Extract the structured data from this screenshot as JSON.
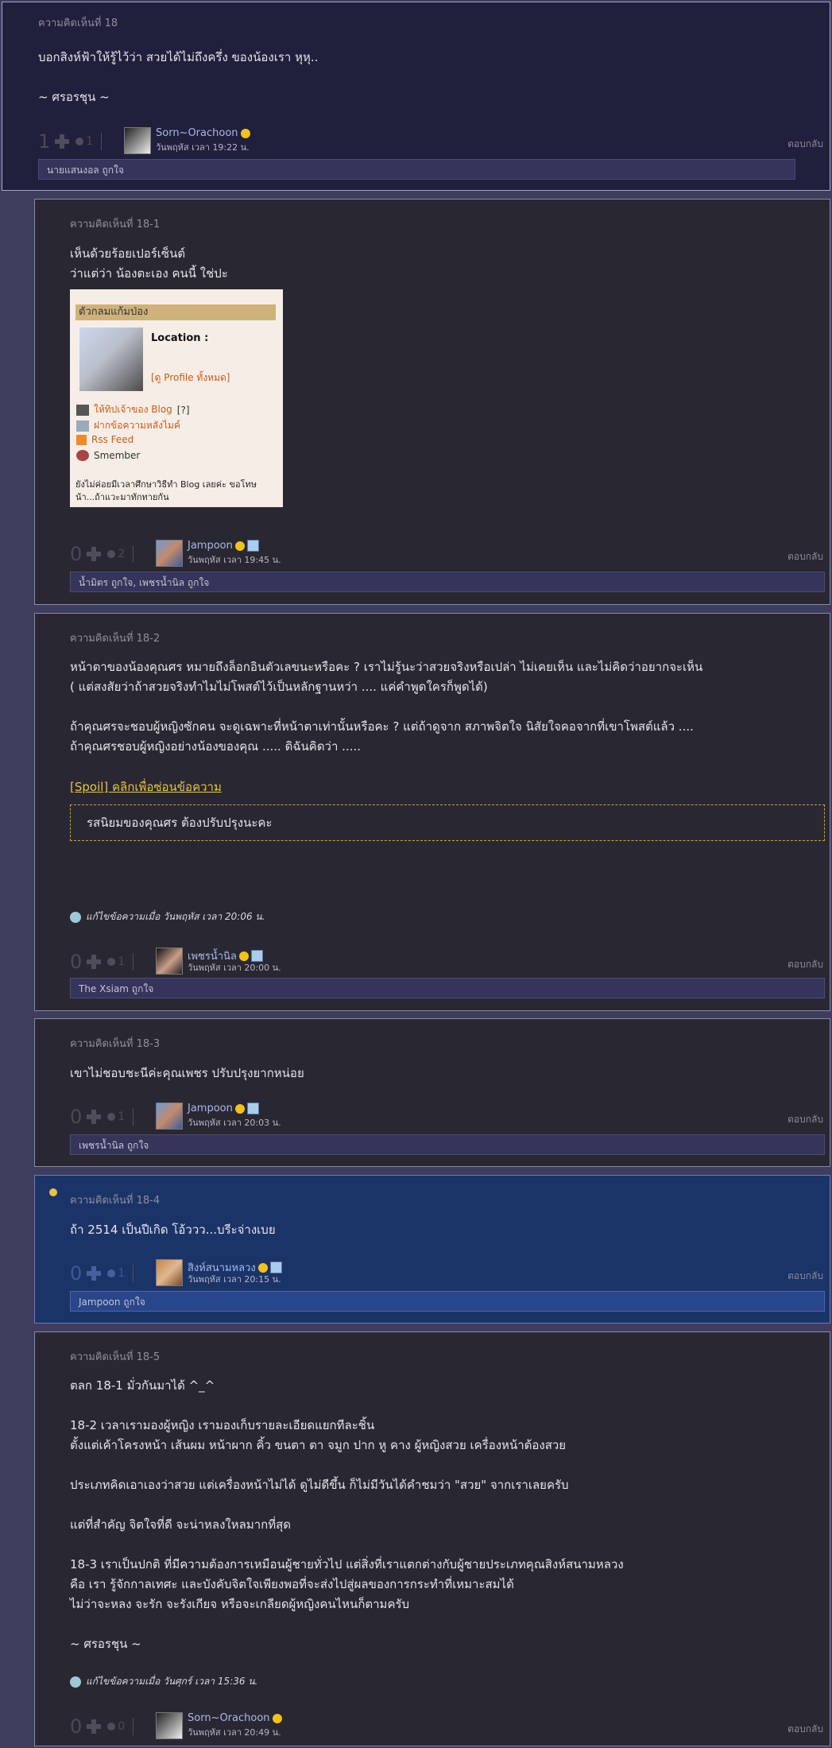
{
  "like_suffix": "ถูกใจ",
  "reply_label": "ตอบกลับ",
  "comments": [
    {
      "header": "ความคิดเห็นที่ 18",
      "body": "บอกสิงห์ฟ้าให้รู้ไว้ว่า สวยได้ไม่ถึงครึ่ง ของน้องเรา  หุหุ..\n\n~ ศรอรชุน ~",
      "votes": "1",
      "comments": "1",
      "user": "Sorn~Orachoon",
      "time": "วันพฤหัส เวลา 19:22 น.",
      "likes": "นายแสนงอล ถูกใจ"
    },
    {
      "header": "ความคิดเห็นที่ 18-1",
      "body": "เห็นด้วยร้อยเปอร์เซ็นต์\nว่าแต่ว่า น้องตะเอง  คนนี้  ใช่ปะ",
      "votes": "0",
      "comments": "2",
      "user": "Jampoon",
      "time": "วันพฤหัส เวลา 19:45 น.",
      "likes": "น้ำมิตร ถูกใจ, เพชรน้ำนิล ถูกใจ",
      "widget": {
        "title": "ตัวกลมแก้มป่อง",
        "location": "Location :",
        "profile_link": "[ดู Profile ทั้งหมด]",
        "tip_link": "ให้ทิปเจ้าของ Blog",
        "tip_help": "[?]",
        "msg_link": "ฝากข้อความหลังไมค์",
        "rss": "Rss Feed",
        "member": "Smember",
        "note": "ยังไม่ค่อยมีเวลาศึกษาวิธีทำ Blog เลยค่ะ ขอโทษน้า...ถ้าแวะมาทักทายกัน"
      }
    },
    {
      "header": "ความคิดเห็นที่ 18-2",
      "body": "หน้าตาของน้องคุณศร หมายถึงล็อกอินตัวเลขนะหรือคะ ? เราไม่รู้นะว่าสวยจริงหรือเปล่า ไม่เคยเห็น และไม่คิดว่าอยากจะเห็น\n( แต่สงสัยว่าถ้าสวยจริงทำไมไม่โพสต์ไว้เป็นหลักฐานหว่า .... แค่คำพูดใครก็พูดได้)\n\nถ้าคุณศรจะชอบผู้หญิงซักคน จะดูเฉพาะที่หน้าตาเท่านั้นหรือคะ ?  แต่ถ้าดูจาก สภาพจิตใจ นิสัยใจคอจากที่เขาโพสต์แล้ว ....\nถ้าคุณศรชอบผู้หญิงอย่างน้องของคุณ ..... ดิฉันคิดว่า .....",
      "spoil_link": "[Spoil] คลิกเพื่อซ่อนข้อความ",
      "spoil_text": "รสนิยมของคุณศร ต้องปรับปรุงนะคะ",
      "edited": "แก้ไขข้อความเมื่อ วันพฤหัส เวลา 20:06 น.",
      "votes": "0",
      "comments": "1",
      "user": "เพชรน้ำนิล",
      "time": "วันพฤหัส เวลา 20:00 น.",
      "likes": "The Xsiam ถูกใจ"
    },
    {
      "header": "ความคิดเห็นที่ 18-3",
      "body": "เขาไม่ชอบชะนีค่ะคุณเพชร  ปรับปรุงยากหน่อย",
      "votes": "0",
      "comments": "1",
      "user": "Jampoon",
      "time": "วันพฤหัส เวลา 20:03 น.",
      "likes": "เพชรน้ำนิล ถูกใจ"
    },
    {
      "header": "ความคิดเห็นที่ 18-4",
      "body": "ถ้า 2514 เป็นปีเกิด โอ้ววว...บรีะจ่างเบย",
      "votes": "0",
      "comments": "1",
      "user": "สิงห์สนามหลวง",
      "time": "วันพฤหัส เวลา 20:15 น.",
      "likes": "Jampoon ถูกใจ"
    },
    {
      "header": "ความคิดเห็นที่ 18-5",
      "body": "ตลก 18-1 มั่วกันมาได้ ^_^\n\n18-2 เวลาเรามองผู้หญิง  เรามองเก็บรายละเอียดแยกทีละชิ้น\nตั้งแต่เค้าโครงหน้า เส้นผม หน้าผาก คิ้ว ขนตา ตา จมูก ปาก หู คาง ผู้หญิงสวย เครื่องหน้าต้องสวย\n\nประเภทคิดเอาเองว่าสวย แต่เครื่องหน้าไม่ได้ ดูไม่ดีขึ้น  ก็ไม่มีวันได้คำชมว่า \"สวย\" จากเราเลยครับ\n\nแต่ที่สำคัญ จิตใจที่ดี จะน่าหลงใหลมากที่สุด\n\n18-3 เราเป็นปกติ ที่มีความต้องการเหมือนผู้ชายทั่วไป  แต่สิ่งที่เราแตกต่างกับผู้ชายประเภทคุณสิงห์สนามหลวง\nคือ เรา รู้จักกาลเทศะ และบังคับจิตใจเพียงพอที่จะส่งไปสู่ผลของการกระทำที่เหมาะสมได้\nไม่ว่าจะหลง จะรัก จะรังเกียจ หรือจะเกลียดผู้หญิงคนไหนก็ตามครับ\n\n~ ศรอรชุน ~",
      "edited": "แก้ไขข้อความเมื่อ วันศุกร์ เวลา 15:36 น.",
      "votes": "0",
      "comments": "0",
      "user": "Sorn~Orachoon",
      "time": "วันพฤหัส เวลา 20:49 น."
    }
  ]
}
